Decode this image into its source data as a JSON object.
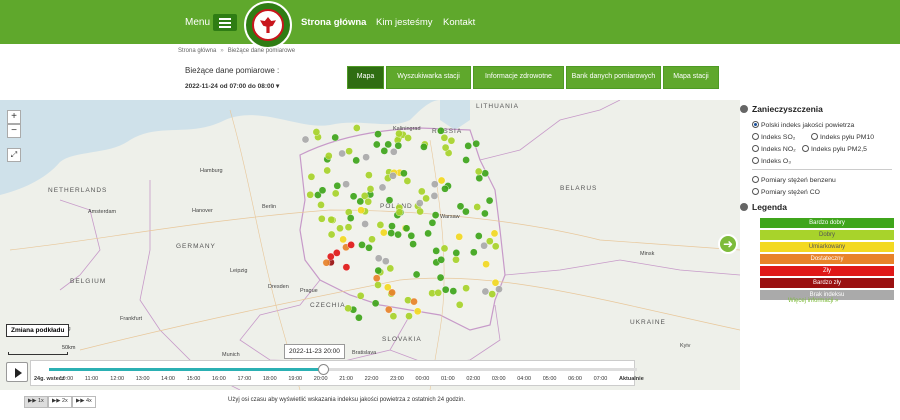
{
  "header": {
    "menu_label": "Menu",
    "logo_icon": "coat-of-arms-icon",
    "nav": [
      {
        "label": "Strona główna",
        "active": true
      },
      {
        "label": "Kim jesteśmy",
        "active": false
      },
      {
        "label": "Kontakt",
        "active": false
      }
    ]
  },
  "breadcrumb": {
    "home": "Strona główna",
    "separator": "»",
    "current": "Bieżące dane pomiarowe"
  },
  "measurements": {
    "title": "Bieżące dane pomiarowe :",
    "date_range": "2022-11-24 od 07:00 do 08:00 ▾"
  },
  "tabs": [
    {
      "label": "Mapa",
      "active": true
    },
    {
      "label": "Wyszukiwarka stacji",
      "active": false
    },
    {
      "label": "Informacje zdrowotne",
      "active": false
    },
    {
      "label": "Bank danych pomiarowych",
      "active": false
    },
    {
      "label": "Mapa stacji",
      "active": false
    }
  ],
  "map": {
    "zoom_in": "+",
    "zoom_out": "−",
    "fullscreen_icon": "expand-icon",
    "switch_basemap": "Zmiana podkładu",
    "scale_label": "50km",
    "next_icon": "arrow-right-icon",
    "places": [
      {
        "text": "LITHUANIA",
        "country": true
      },
      {
        "text": "RUSSIA",
        "country": true
      },
      {
        "text": "Kaliningrad",
        "country": false
      },
      {
        "text": "BELARUS",
        "country": true
      },
      {
        "text": "POLAND",
        "country": true
      },
      {
        "text": "Warsaw",
        "country": false
      },
      {
        "text": "GERMANY",
        "country": true
      },
      {
        "text": "NETHERLANDS",
        "country": true
      },
      {
        "text": "BELGIUM",
        "country": true
      },
      {
        "text": "CZECHIA",
        "country": true
      },
      {
        "text": "SLOVAKIA",
        "country": true
      },
      {
        "text": "UKRAINE",
        "country": true
      },
      {
        "text": "Hamburg",
        "country": false
      },
      {
        "text": "Berlin",
        "country": false
      },
      {
        "text": "Amsterdam",
        "country": false
      },
      {
        "text": "Hanover",
        "country": false
      },
      {
        "text": "Leipzig",
        "country": false
      },
      {
        "text": "Dresden",
        "country": false
      },
      {
        "text": "Prague",
        "country": false
      },
      {
        "text": "Munich",
        "country": false
      },
      {
        "text": "Bratislava",
        "country": false
      },
      {
        "text": "Minsk",
        "country": false
      },
      {
        "text": "Kyiv",
        "country": false
      },
      {
        "text": "Luxembourg",
        "country": false
      },
      {
        "text": "Frankfurt",
        "country": false
      },
      {
        "text": "Stuttgart",
        "country": false
      }
    ]
  },
  "timeline": {
    "selected": "2022-11-23 20:00",
    "play_icon": "play-icon",
    "ticks": [
      "24g. wstecz",
      "10:00",
      "11:00",
      "12:00",
      "13:00",
      "14:00",
      "15:00",
      "16:00",
      "17:00",
      "18:00",
      "19:00",
      "20:00",
      "21:00",
      "22:00",
      "23:00",
      "00:00",
      "01:00",
      "02:00",
      "03:00",
      "04:00",
      "05:00",
      "06:00",
      "07:00",
      "Aktualnie"
    ],
    "progress": 0.48,
    "speeds": [
      "1x",
      "2x",
      "4x"
    ],
    "note": "Użyj osi czasu aby wyświetlić wskazania indeksu jakości powietrza z ostatnich 24 godzin."
  },
  "sidebar": {
    "pollution_title": "Zanieczyszczenia",
    "pollutants": [
      {
        "label": "Polski indeks jakości powietrza",
        "checked": true
      },
      {
        "label": "Indeks SO₂",
        "checked": false
      },
      {
        "label": "Indeks pyłu PM10",
        "checked": false
      },
      {
        "label": "Indeks NO₂",
        "checked": false
      },
      {
        "label": "Indeks pyłu PM2,5",
        "checked": false
      },
      {
        "label": "Indeks O₃",
        "checked": false
      },
      {
        "label": "Pomiary stężeń benzenu",
        "checked": false
      },
      {
        "label": "Pomiary stężeń CO",
        "checked": false
      }
    ],
    "legend_title": "Legenda",
    "legend": [
      {
        "label": "Bardzo dobry",
        "color": "#3fa51b"
      },
      {
        "label": "Dobry",
        "color": "#a8d32b"
      },
      {
        "label": "Umiarkowany",
        "color": "#f3d922"
      },
      {
        "label": "Dostateczny",
        "color": "#e8832a"
      },
      {
        "label": "Zły",
        "color": "#e01818"
      },
      {
        "label": "Bardzo zły",
        "color": "#9a1010"
      },
      {
        "label": "Brak indeksu",
        "color": "#aaaaaa"
      }
    ],
    "more_info": "Więcej informacji »"
  },
  "colors": {
    "brand": "#5fa82c",
    "brand_dark": "#2f6d12",
    "accent": "#2bb0b3"
  }
}
